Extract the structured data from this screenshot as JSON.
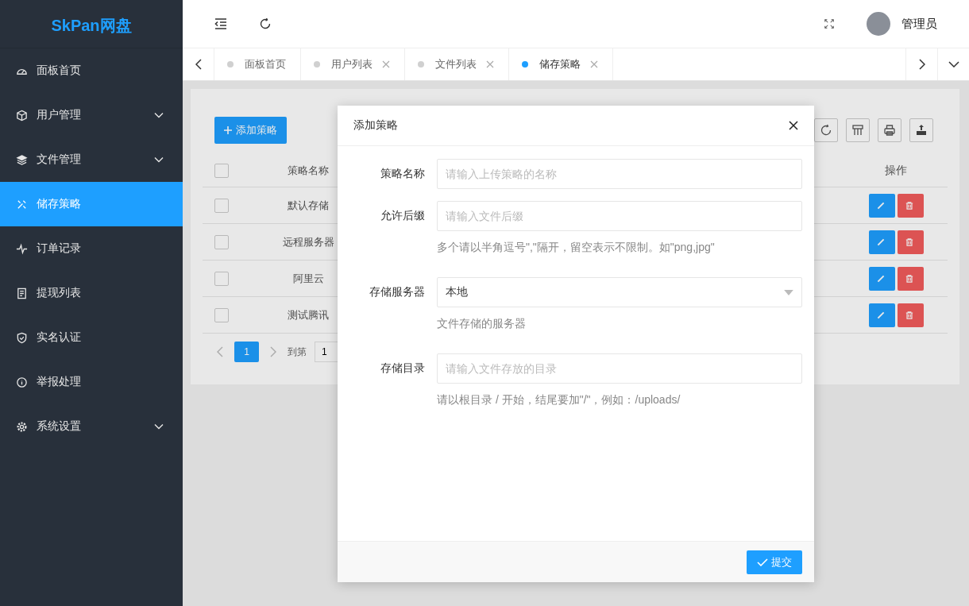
{
  "sidebar": {
    "logo": "SkPan网盘",
    "items": [
      {
        "label": "面板首页",
        "selected": false,
        "expandable": false
      },
      {
        "label": "用户管理",
        "selected": false,
        "expandable": true
      },
      {
        "label": "文件管理",
        "selected": false,
        "expandable": true
      },
      {
        "label": "储存策略",
        "selected": true,
        "expandable": false
      },
      {
        "label": "订单记录",
        "selected": false,
        "expandable": false
      },
      {
        "label": "提现列表",
        "selected": false,
        "expandable": false
      },
      {
        "label": "实名认证",
        "selected": false,
        "expandable": false
      },
      {
        "label": "举报处理",
        "selected": false,
        "expandable": false
      },
      {
        "label": "系统设置",
        "selected": false,
        "expandable": true
      }
    ]
  },
  "header": {
    "user": "管理员"
  },
  "tabs": [
    {
      "label": "面板首页",
      "selected": false,
      "closable": false
    },
    {
      "label": "用户列表",
      "selected": false,
      "closable": true
    },
    {
      "label": "文件列表",
      "selected": false,
      "closable": true
    },
    {
      "label": "储存策略",
      "selected": true,
      "closable": true
    }
  ],
  "toolbar": {
    "add_button": "添加策略"
  },
  "table": {
    "columns": [
      "策略名称",
      "操作"
    ],
    "header_checked": false,
    "rows": [
      {
        "name": "默认存储",
        "checked": false
      },
      {
        "name": "远程服务器",
        "checked": false
      },
      {
        "name": "阿里云",
        "checked": false
      },
      {
        "name": "测试腾讯",
        "checked": false
      }
    ]
  },
  "pagination": {
    "pages": [
      {
        "label": "1",
        "selected": true
      }
    ],
    "goto_label": "到第",
    "goto_value": "1"
  },
  "dialog": {
    "title": "添加策略",
    "fields": [
      {
        "kind": "text",
        "label": "策略名称",
        "placeholder": "请输入上传策略的名称"
      },
      {
        "kind": "text",
        "label": "允许后缀",
        "placeholder": "请输入文件后缀",
        "help": "多个请以半角逗号\",\"隔开，留空表示不限制。如\"png,jpg\""
      },
      {
        "kind": "select",
        "label": "存储服务器",
        "value": "本地",
        "help": "文件存储的服务器"
      },
      {
        "kind": "text",
        "label": "存储目录",
        "placeholder": "请输入文件存放的目录",
        "help": "请以根目录 / 开始，结尾要加\"/\"，例如：/uploads/"
      }
    ],
    "submit": "提交"
  }
}
